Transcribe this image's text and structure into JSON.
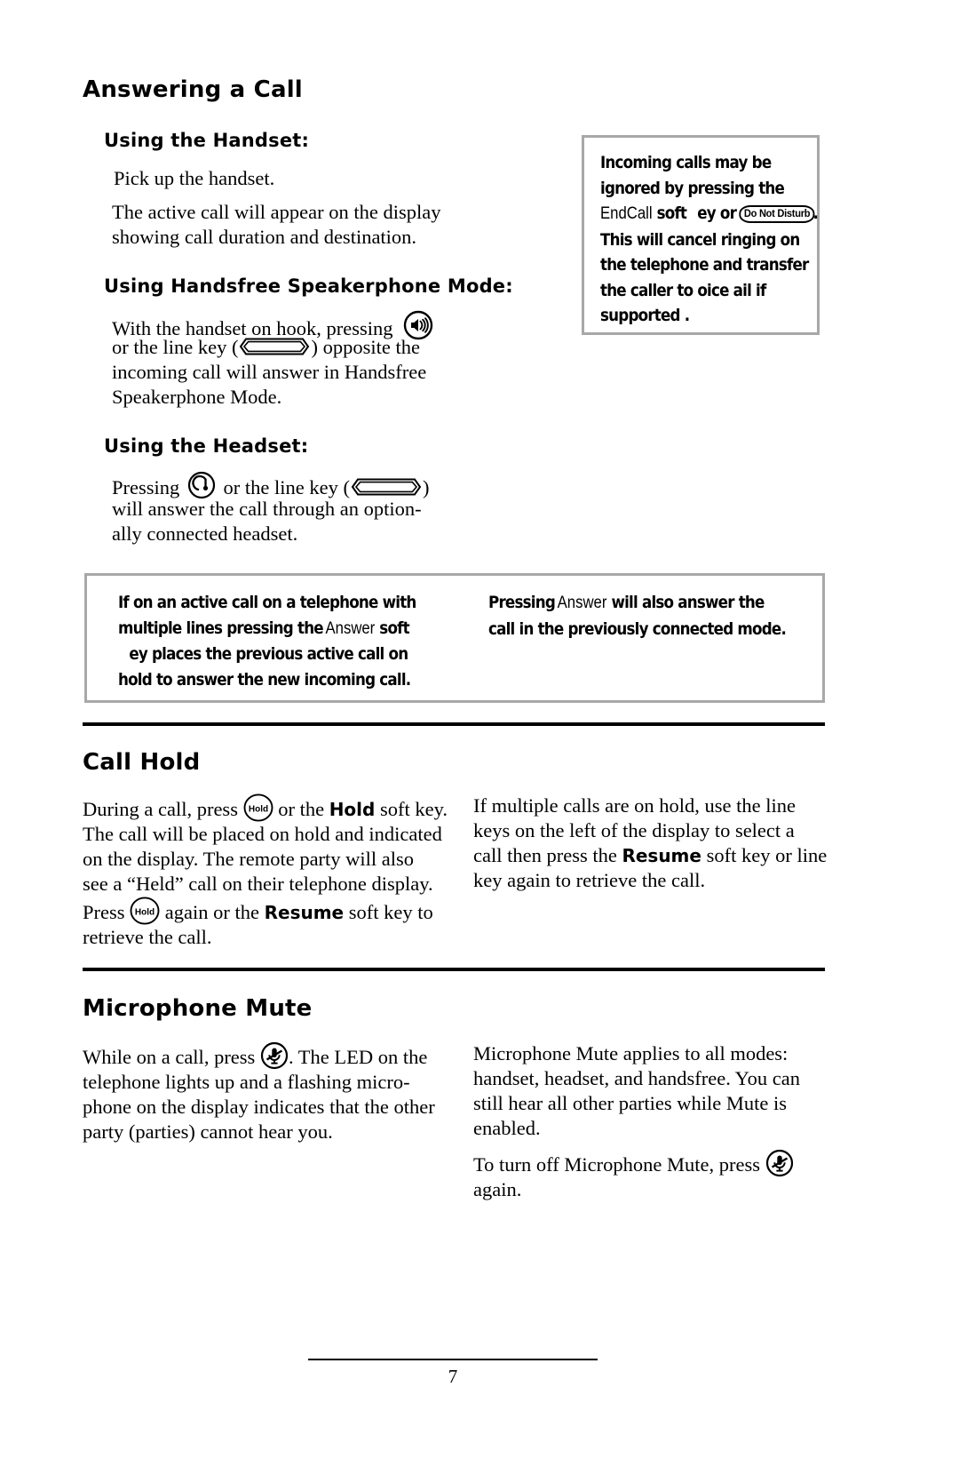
{
  "page": {
    "number": "7"
  },
  "sections": {
    "answering": {
      "title": "Answering a Call",
      "handset": {
        "heading": "Using the Handset:",
        "line1": "Pick up the handset.",
        "line2a": "The active call will appear on the display",
        "line2b": "showing call duration and destination."
      },
      "speakerphone": {
        "heading": "Using Handsfree Speakerphone Mode:",
        "line1_before": "With the handset on hook, pressing",
        "line2_before": "or the line key (",
        "line2_after": ") opposite the",
        "line3": "incoming call will answer in Handsfree",
        "line4": "Speakerphone Mode."
      },
      "headset": {
        "heading": "Using the Headset:",
        "line1_before": "Pressing",
        "line1_mid": "or the line key (",
        "line1_after": ")",
        "line2": "will answer the call through an option-",
        "line3": "ally connected headset."
      }
    },
    "note_dnd": {
      "line1": "Incoming calls may be",
      "line2": "ignored by pressing the",
      "line3a": "EndCall",
      "line3b": "soft",
      "line3c": "ey or",
      "badge": "Do Not Disturb",
      "line3d": ".",
      "line4": "This will cancel ringing on",
      "line5": "the telephone and transfer",
      "line6": "the caller to  oice    ail  if",
      "line7": "supported ."
    },
    "note_answer": {
      "left": {
        "line1": "If on an active call on a telephone with",
        "line2a": "multiple lines  pressing the",
        "line2b": "Answer",
        "line2c": "soft",
        "line3": "ey places the previous active call on",
        "line4": "hold to answer the new incoming call."
      },
      "right": {
        "line1a": "Pressing",
        "line1b": "Answer",
        "line1c": "will also answer the",
        "line2": "call in the previously connected mode."
      }
    },
    "call_hold": {
      "title": "Call Hold",
      "left": {
        "l1_before": "During a call, press",
        "l1_mid": "or the",
        "l1_strong": "Hold",
        "l1_after": "soft key.",
        "l2": "The call will be placed on hold and indicated",
        "l3": "on the display.  The remote party will also",
        "l4": "see a “Held” call on their telephone display.",
        "l5_before": "Press",
        "l5_mid": "again or the",
        "l5_strong": "Resume",
        "l5_after": "soft key to",
        "l6": "retrieve the call."
      },
      "right": {
        "l1": "If multiple calls are on hold, use the line",
        "l2": "keys on the left of the display to select a",
        "l3_before": "call then press the",
        "l3_strong": "Resume",
        "l3_after": "soft key or line",
        "l4": "key again to retrieve the call."
      }
    },
    "mic_mute": {
      "title": "Microphone Mute",
      "left": {
        "l1_before": "While on a call, press",
        "l1_after": ".  The LED on the",
        "l2": "telephone lights up and a flashing micro-",
        "l3": "phone on the display indicates that the other",
        "l4": "party (parties) cannot hear you."
      },
      "right": {
        "l1": "Microphone Mute applies to all modes:",
        "l2": "handset, headset, and handsfree.  You can",
        "l3": "still hear all other parties while Mute is",
        "l4": "enabled.",
        "l5_before": "To turn off Microphone Mute, press",
        "l6": "again."
      }
    }
  },
  "icons": {
    "speaker": "speaker-icon",
    "headset": "headset-icon",
    "hold": "Hold",
    "mute": "mute-microphone-icon",
    "line_key": "line-key-icon"
  },
  "colors": {
    "text": "#000000",
    "note_border": "#a8a8a8",
    "rule": "#000000",
    "background": "#ffffff"
  }
}
